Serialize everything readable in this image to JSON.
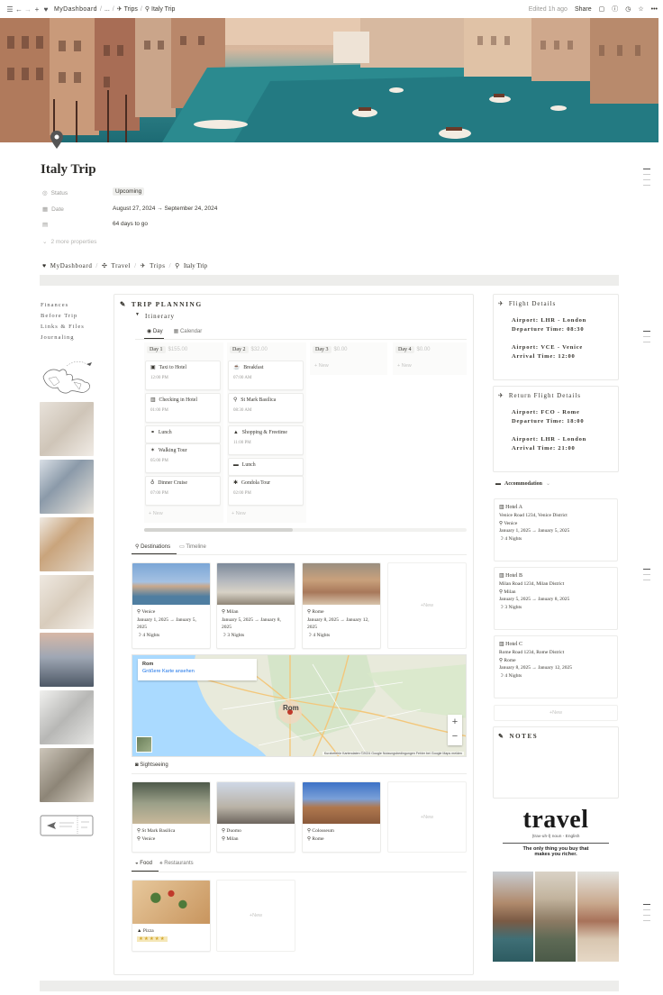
{
  "topbar": {
    "crumbs": [
      "MyDashboard",
      "...",
      "Trips",
      "Italy Trip"
    ],
    "edited": "Edited 1h ago",
    "share": "Share"
  },
  "page": {
    "title": "Italy Trip",
    "props": [
      {
        "label": "Status",
        "value": "Upcoming",
        "icon": "status-icon"
      },
      {
        "label": "Date",
        "value": "August 27, 2024 → September 24, 2024",
        "icon": "calendar-icon"
      },
      {
        "label": "",
        "value": "64 days to go",
        "icon": "formula-icon"
      }
    ],
    "more_props": "2 more properties",
    "crumbs": [
      "MyDashboard",
      "Travel",
      "Trips",
      "Italy Trip"
    ]
  },
  "nav": {
    "links": [
      "Finances",
      "Before Trip",
      "Links & Files",
      "Journaling"
    ]
  },
  "planning": {
    "title": "TRIP PLANNING",
    "itinerary": "Itinerary",
    "tabs": [
      "Day",
      "Calendar"
    ],
    "days": [
      {
        "label": "Day 1",
        "cost": "$155.00",
        "items": [
          {
            "name": "Taxi to Hotel",
            "time": "12:00 PM"
          },
          {
            "name": "Checking in Hotel",
            "time": "01:00 PM"
          },
          {
            "name": "Lunch",
            "time": ""
          },
          {
            "name": "Walking Tour",
            "time": "05:00 PM"
          },
          {
            "name": "Dinner Cruise",
            "time": "07:00 PM"
          }
        ]
      },
      {
        "label": "Day 2",
        "cost": "$32.00",
        "items": [
          {
            "name": "Breakfast",
            "time": "07:00 AM"
          },
          {
            "name": "St Mark Basilica",
            "time": "08:30 AM"
          },
          {
            "name": "Shopping & Freetime",
            "time": "11:00 PM"
          },
          {
            "name": "Lunch",
            "time": ""
          },
          {
            "name": "Gondola Tour",
            "time": "02:00 PM"
          }
        ]
      },
      {
        "label": "Day 3",
        "cost": "$0.00",
        "items": []
      },
      {
        "label": "Day 4",
        "cost": "$0.00",
        "items": []
      }
    ],
    "new_label": "New",
    "dest_tabs": [
      "Destinations",
      "Timeline"
    ],
    "destinations": [
      {
        "name": "Venice",
        "dates": "January 1, 2025 → January 5, 2025",
        "nights": "4 Nights"
      },
      {
        "name": "Milan",
        "dates": "January 5, 2025 → January 8, 2025",
        "nights": "3 Nights"
      },
      {
        "name": "Rome",
        "dates": "January 8, 2025 → January 12, 2025",
        "nights": "4 Nights"
      }
    ],
    "map": {
      "place": "Rom",
      "link": "Größere Karte ansehen",
      "city_label": "Rom",
      "footer": "Kurzbefehle   Kartendaten ©2024 Google   Nutzungsbedingungen   Fehler bei Google Maps melden"
    },
    "sightseeing_label": "Sightseeing",
    "sights": [
      {
        "name": "St Mark Basilica",
        "city": "Venice"
      },
      {
        "name": "Duomo",
        "city": "Milan"
      },
      {
        "name": "Colosseum",
        "city": "Rome"
      }
    ],
    "food_tabs": [
      "Food",
      "Restaurants"
    ],
    "food": [
      {
        "name": "Pizza",
        "rating": "★★★★★"
      }
    ]
  },
  "flight": {
    "title": "Flight Details",
    "rows": [
      {
        "k": "Airport:",
        "v": "LHR - London"
      },
      {
        "k": "Departure Time:",
        "v": "08:30"
      },
      {
        "k": "Airport:",
        "v": "VCE - Venice"
      },
      {
        "k": "Arrival Time:",
        "v": "12:00"
      }
    ]
  },
  "return_flight": {
    "title": "Return Flight Details",
    "rows": [
      {
        "k": "Airport:",
        "v": "FCO - Rome"
      },
      {
        "k": "Departure Time:",
        "v": "18:00"
      },
      {
        "k": "Airport:",
        "v": "LHR - London"
      },
      {
        "k": "Arrival Time:",
        "v": "21:00"
      }
    ]
  },
  "accommodation": {
    "title": "Accommodation",
    "hotels": [
      {
        "name": "Hotel A",
        "address": "Venice Road 1234, Venice District",
        "city": "Venice",
        "dates": "January 1, 2025 → January 5, 2025",
        "nights": "4 Nights"
      },
      {
        "name": "Hotel B",
        "address": "Milan Road 1234, Milan District",
        "city": "Milan",
        "dates": "January 5, 2025 → January 8, 2025",
        "nights": "3 Nights"
      },
      {
        "name": "Hotel C",
        "address": "Rome Road 1234, Rome District",
        "city": "Rome",
        "dates": "January 8, 2025 → January 12, 2025",
        "nights": "4 Nights"
      }
    ]
  },
  "notes": {
    "title": "NOTES"
  },
  "quote": {
    "word": "travel",
    "phonetic": "(trav-uh-l) noun - English",
    "line1": "The only thing you buy that",
    "line2": "makes you richer."
  },
  "colors": {
    "accent": "#37352f",
    "muted": "#9b9a97",
    "rating": "#f5e7b8"
  }
}
